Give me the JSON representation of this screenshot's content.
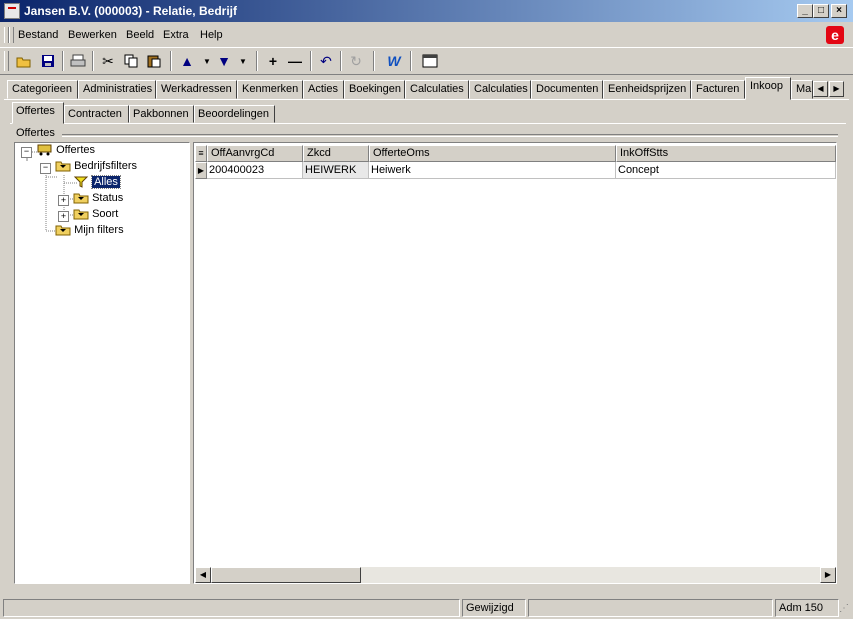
{
  "window": {
    "title": "Jansen B.V. (000003) - Relatie, Bedrijf"
  },
  "menu": [
    "Bestand",
    "Bewerken",
    "Beeld",
    "Extra",
    "Help"
  ],
  "toolbar": [
    "open-icon",
    "save-icon",
    "print-icon",
    "cut-icon",
    "copy-icon",
    "paste-icon",
    "arrow-up-icon",
    "arrow-down-icon",
    "plus-icon",
    "minus-icon",
    "undo-icon",
    "refresh-icon",
    "word-icon",
    "window-icon"
  ],
  "tabs": [
    "Categorieen",
    "Administraties",
    "Werkadressen",
    "Kenmerken",
    "Acties",
    "Boekingen",
    "Calculaties",
    "Calculaties",
    "Documenten",
    "Eenheidsprijzen",
    "Facturen",
    "Inkoop",
    "Ma"
  ],
  "active_tab": "Inkoop",
  "subtabs": [
    "Offertes",
    "Contracten",
    "Pakbonnen",
    "Beoordelingen"
  ],
  "active_subtab": "Offertes",
  "group_label": "Offertes",
  "tree": {
    "root": "Offertes",
    "bedrijfsfilters": "Bedrijfsfilters",
    "alles": "Alles",
    "status": "Status",
    "soort": "Soort",
    "mijn_filters": "Mijn filters"
  },
  "grid": {
    "columns": [
      "OffAanvrgCd",
      "Zkcd",
      "OfferteOms",
      "InkOffStts"
    ],
    "rows": [
      [
        "200400023",
        "HEIWERK",
        "Heiwerk",
        "Concept"
      ]
    ]
  },
  "statusbar": {
    "left": "",
    "middle": "Gewijzigd",
    "mid2": "",
    "right": "Adm 150"
  },
  "colors": {
    "titlebar_start": "#0a246a",
    "titlebar_end": "#a6caf0",
    "selection": "#0a246a",
    "logo": "#e30613"
  }
}
